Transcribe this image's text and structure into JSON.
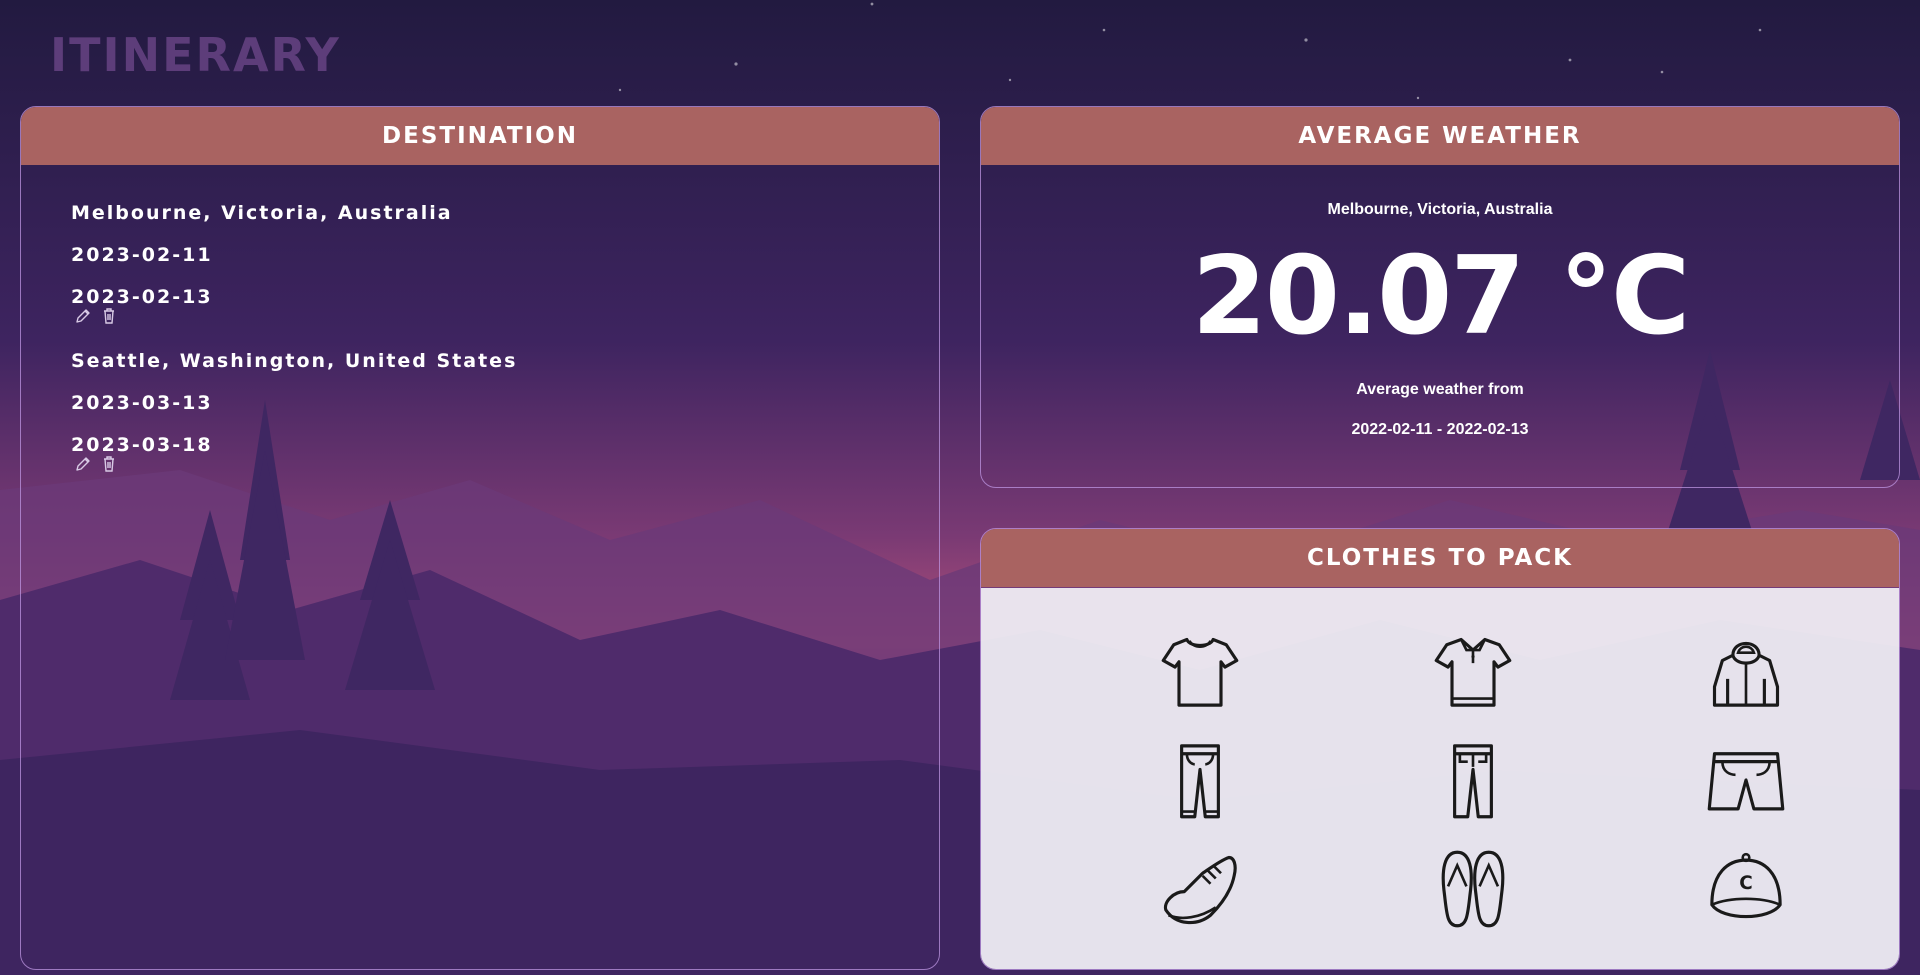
{
  "app": {
    "title": "ITINERARY"
  },
  "colors": {
    "header": "#a96361",
    "title": "#5d3d7a",
    "card_border": "#be96e1",
    "clothes_panel": "#efedf3"
  },
  "destination": {
    "header": "DESTINATION",
    "trips": [
      {
        "place": "Melbourne, Victoria, Australia",
        "start": "2023-02-11",
        "end": "2023-02-13",
        "actions": [
          "pencil-icon",
          "trash-icon"
        ]
      },
      {
        "place": "Seattle, Washington, United States",
        "start": "2023-03-13",
        "end": "2023-03-18",
        "actions": [
          "pencil-icon",
          "trash-icon"
        ]
      }
    ]
  },
  "weather": {
    "header": "AVERAGE WEATHER",
    "city": "Melbourne, Victoria, Australia",
    "temperature": "20.07 °C",
    "from_label": "Average weather from",
    "range": "2022-02-11 - 2022-02-13"
  },
  "clothes": {
    "header": "CLOTHES TO PACK",
    "items": [
      "t-shirt-icon",
      "polo-shirt-icon",
      "hoodie-icon",
      "trousers-icon",
      "jeans-icon",
      "shorts-icon",
      "sneaker-icon",
      "flip-flops-icon",
      "cap-icon"
    ]
  }
}
